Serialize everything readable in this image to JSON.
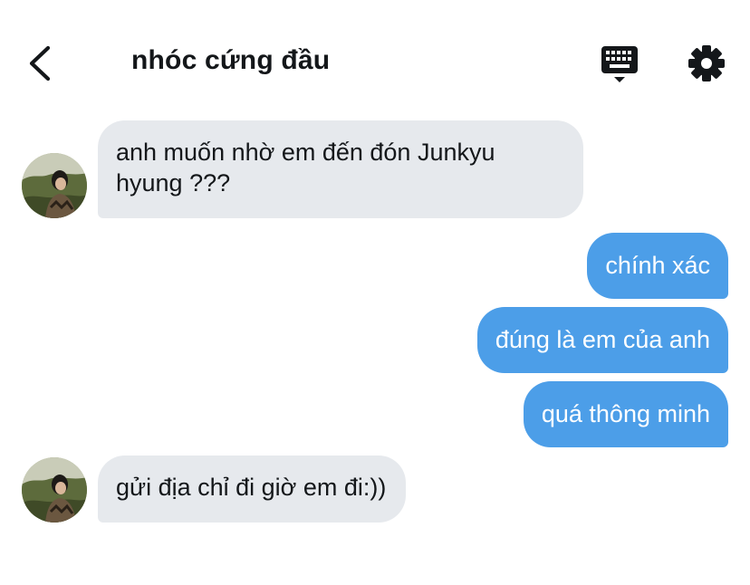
{
  "header": {
    "back_icon": "chevron-left-icon",
    "title": "nhóc cứng đầu",
    "keyboard_icon": "keyboard-icon",
    "settings_icon": "gear-icon"
  },
  "colors": {
    "incoming_bubble": "#e6e9ed",
    "outgoing_bubble": "#4c9ee8",
    "text": "#14171a"
  },
  "messages": [
    {
      "direction": "incoming",
      "text": "anh muốn nhờ em đến đón Junkyu hyung ???"
    },
    {
      "direction": "outgoing",
      "text": "chính xác"
    },
    {
      "direction": "outgoing",
      "text": "đúng là em của anh"
    },
    {
      "direction": "outgoing",
      "text": "quá thông minh"
    },
    {
      "direction": "incoming",
      "text": "gửi địa chỉ đi giờ em đi:))"
    }
  ]
}
